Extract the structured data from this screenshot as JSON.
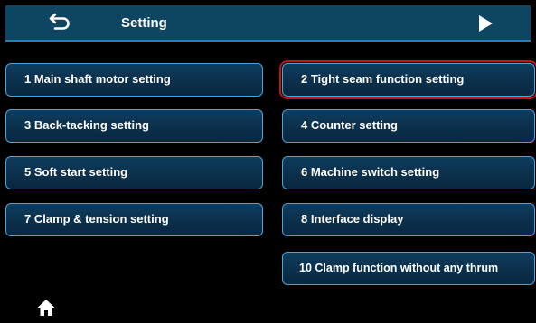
{
  "header": {
    "title": "Setting",
    "back_icon": "back-arrow-icon",
    "next_icon": "play-next-icon",
    "background_color": "#0e4562"
  },
  "menu": {
    "items": [
      {
        "label": "1  Main shaft motor setting"
      },
      {
        "label": "2  Tight seam function setting",
        "selected": true
      },
      {
        "label": "3  Back-tacking setting"
      },
      {
        "label": "4  Counter setting"
      },
      {
        "label": "5  Soft start setting"
      },
      {
        "label": "6  Machine switch setting"
      },
      {
        "label": "7  Clamp & tension setting"
      },
      {
        "label": "8  Interface display"
      },
      {
        "label": "10 Clamp function without any thrum"
      }
    ],
    "border_color": "#4aa3d9",
    "selected_outline_color": "#c0141c"
  },
  "footer": {
    "home_icon": "home-icon"
  }
}
